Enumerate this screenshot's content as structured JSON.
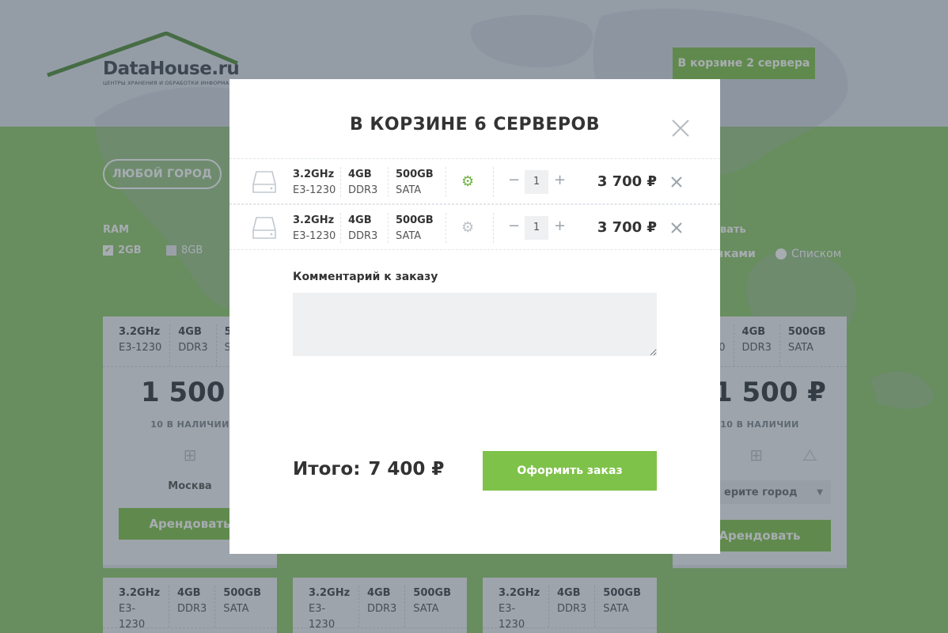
{
  "header": {
    "logo_text": "DataHouse.ru",
    "logo_tagline": "ЦЕНТРЫ ХРАНЕНИЯ И ОБРАБОТКИ ИНФОРМАЦИИ",
    "cart_button": "В корзине 2 сервера"
  },
  "filters": {
    "city_button": "ЛЮБОЙ ГОРОД",
    "ram_label": "RAM",
    "ram_options": [
      {
        "label": "2GB",
        "checked": true
      },
      {
        "label": "8GB",
        "checked": false
      }
    ],
    "view_label": "вать",
    "view_options": [
      {
        "label": "чками",
        "selected": true
      },
      {
        "label": "Списком",
        "selected": false
      }
    ]
  },
  "cards": [
    {
      "cpu": "3.2GHz",
      "cpu_model": "E3-1230",
      "ram": "4GB",
      "ram_type": "DDR3",
      "hdd": "50",
      "hdd_type": "SA",
      "price": "1 500 ₽",
      "stock": "10 В НАЛИЧИИ",
      "city": "Москва",
      "rent": "Арендовать"
    },
    {
      "cpu": "z",
      "cpu_model": "30",
      "ram": "4GB",
      "ram_type": "DDR3",
      "hdd": "500GB",
      "hdd_type": "SATA",
      "price": "1 500 ₽",
      "stock": "10 В НАЛИЧИИ",
      "city": "ерите город",
      "rent": "Арендовать"
    },
    {
      "cpu": "3.2GHz",
      "cpu_model": "E3-1230",
      "ram": "4GB",
      "ram_type": "DDR3",
      "hdd": "500GB",
      "hdd_type": "SATA"
    },
    {
      "cpu": "3.2GHz",
      "cpu_model": "E3-1230",
      "ram": "4GB",
      "ram_type": "DDR3",
      "hdd": "500GB",
      "hdd_type": "SATA"
    },
    {
      "cpu": "3.2GHz",
      "cpu_model": "E3-1230",
      "ram": "4GB",
      "ram_type": "DDR3",
      "hdd": "500GB",
      "hdd_type": "SATA"
    }
  ],
  "modal": {
    "title": "В КОРЗИНЕ 6 СЕРВЕРОВ",
    "items": [
      {
        "cpu": "3.2GHz",
        "cpu_model": "E3-1230",
        "ram": "4GB",
        "ram_type": "DDR3",
        "hdd": "500GB",
        "hdd_type": "SATA",
        "qty": "1",
        "price": "3 700 ₽",
        "gear_color": "#6cb33f"
      },
      {
        "cpu": "3.2GHz",
        "cpu_model": "E3-1230",
        "ram": "4GB",
        "ram_type": "DDR3",
        "hdd": "500GB",
        "hdd_type": "SATA",
        "qty": "1",
        "price": "3 700 ₽",
        "gear_color": "#b9bfc5"
      }
    ],
    "minus": "−",
    "plus": "+",
    "comment_label": "Комментарий к заказу",
    "total_label": "Итого:",
    "total_value": "7 400 ₽",
    "order_button": "Оформить заказ"
  },
  "colors": {
    "accent": "#7fc24a",
    "background": "#8dc76a",
    "header_bg": "#dde4ec"
  }
}
